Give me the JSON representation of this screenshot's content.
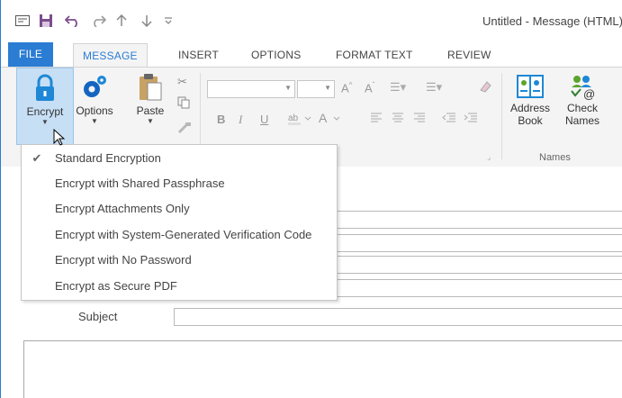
{
  "window": {
    "title": "Untitled - Message (HTML)"
  },
  "qat": {
    "icons": [
      "mail-icon",
      "save-icon",
      "undo-icon",
      "redo-icon",
      "up-arrow-icon",
      "down-arrow-icon",
      "customize-icon"
    ]
  },
  "tabs": [
    {
      "label": "FILE"
    },
    {
      "label": "MESSAGE"
    },
    {
      "label": "INSERT"
    },
    {
      "label": "OPTIONS"
    },
    {
      "label": "FORMAT TEXT"
    },
    {
      "label": "REVIEW"
    }
  ],
  "ribbon": {
    "encrypt_label": "Encrypt",
    "options_label": "Options",
    "paste_label": "Paste",
    "address_book_line1": "Address",
    "address_book_line2": "Book",
    "check_names_line1": "Check",
    "check_names_line2": "Names",
    "basic_text_group_fragment": "xt",
    "names_group": "Names",
    "format_bold": "B",
    "format_italic": "I",
    "format_underline": "U"
  },
  "compose": {
    "subject_label": "Subject"
  },
  "encrypt_menu": {
    "items": [
      {
        "label": "Standard Encryption",
        "checked": true
      },
      {
        "label": "Encrypt with Shared Passphrase",
        "checked": false
      },
      {
        "label": "Encrypt Attachments Only",
        "checked": false
      },
      {
        "label": "Encrypt with System-Generated Verification Code",
        "checked": false
      },
      {
        "label": "Encrypt with No Password",
        "checked": false
      },
      {
        "label": "Encrypt as Secure PDF",
        "checked": false
      }
    ],
    "check_glyph": "✔"
  },
  "colors": {
    "accent": "#2b7cd3",
    "ribbon_bg": "#f4f4f4",
    "highlight": "#c7dff5"
  }
}
